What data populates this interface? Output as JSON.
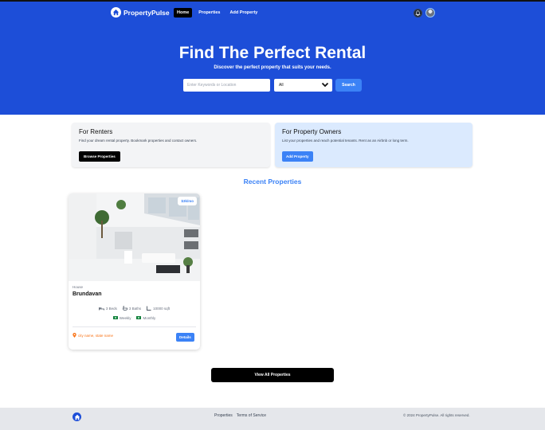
{
  "nav": {
    "brand": "PropertyPulse",
    "links": [
      {
        "label": "Home",
        "active": true
      },
      {
        "label": "Properties",
        "active": false
      },
      {
        "label": "Add Property",
        "active": false
      }
    ],
    "icons": [
      "bell-icon",
      "avatar"
    ]
  },
  "hero": {
    "title": "Find The Perfect Rental",
    "subtitle": "Discover the perfect property that suits your needs.",
    "search_placeholder": "Enter Keywords or Location",
    "type_selected": "All",
    "search_label": "Search"
  },
  "info_boxes": {
    "renters": {
      "title": "For Renters",
      "text": "Find your dream rental property. Bookmark properties and contact owners.",
      "button": "Browse Properties"
    },
    "owners": {
      "title": "For Property Owners",
      "text": "List your properties and reach potential tenants. Rent as an Airbnb or long term.",
      "button": "Add Property"
    }
  },
  "recent": {
    "title": "Recent Properties",
    "properties": [
      {
        "price": "$3k/mo",
        "type": "House",
        "name": "Brundavan",
        "beds": "3 Beds",
        "baths": "3 Baths",
        "sqft": "10000 sqft",
        "rates": [
          "Weekly",
          "Monthly"
        ],
        "location": "city name, state name",
        "details_label": "Details"
      }
    ],
    "view_all": "View All Properties"
  },
  "footer": {
    "links": [
      "Properties",
      "Terms of Service"
    ],
    "copyright": "© 2024 PropertyPulse. All rights reserved."
  },
  "colors": {
    "primary": "#1d4ed8",
    "accent": "#3b82f6",
    "owners_bg": "#dbeafe",
    "renters_bg": "#f3f4f6"
  }
}
